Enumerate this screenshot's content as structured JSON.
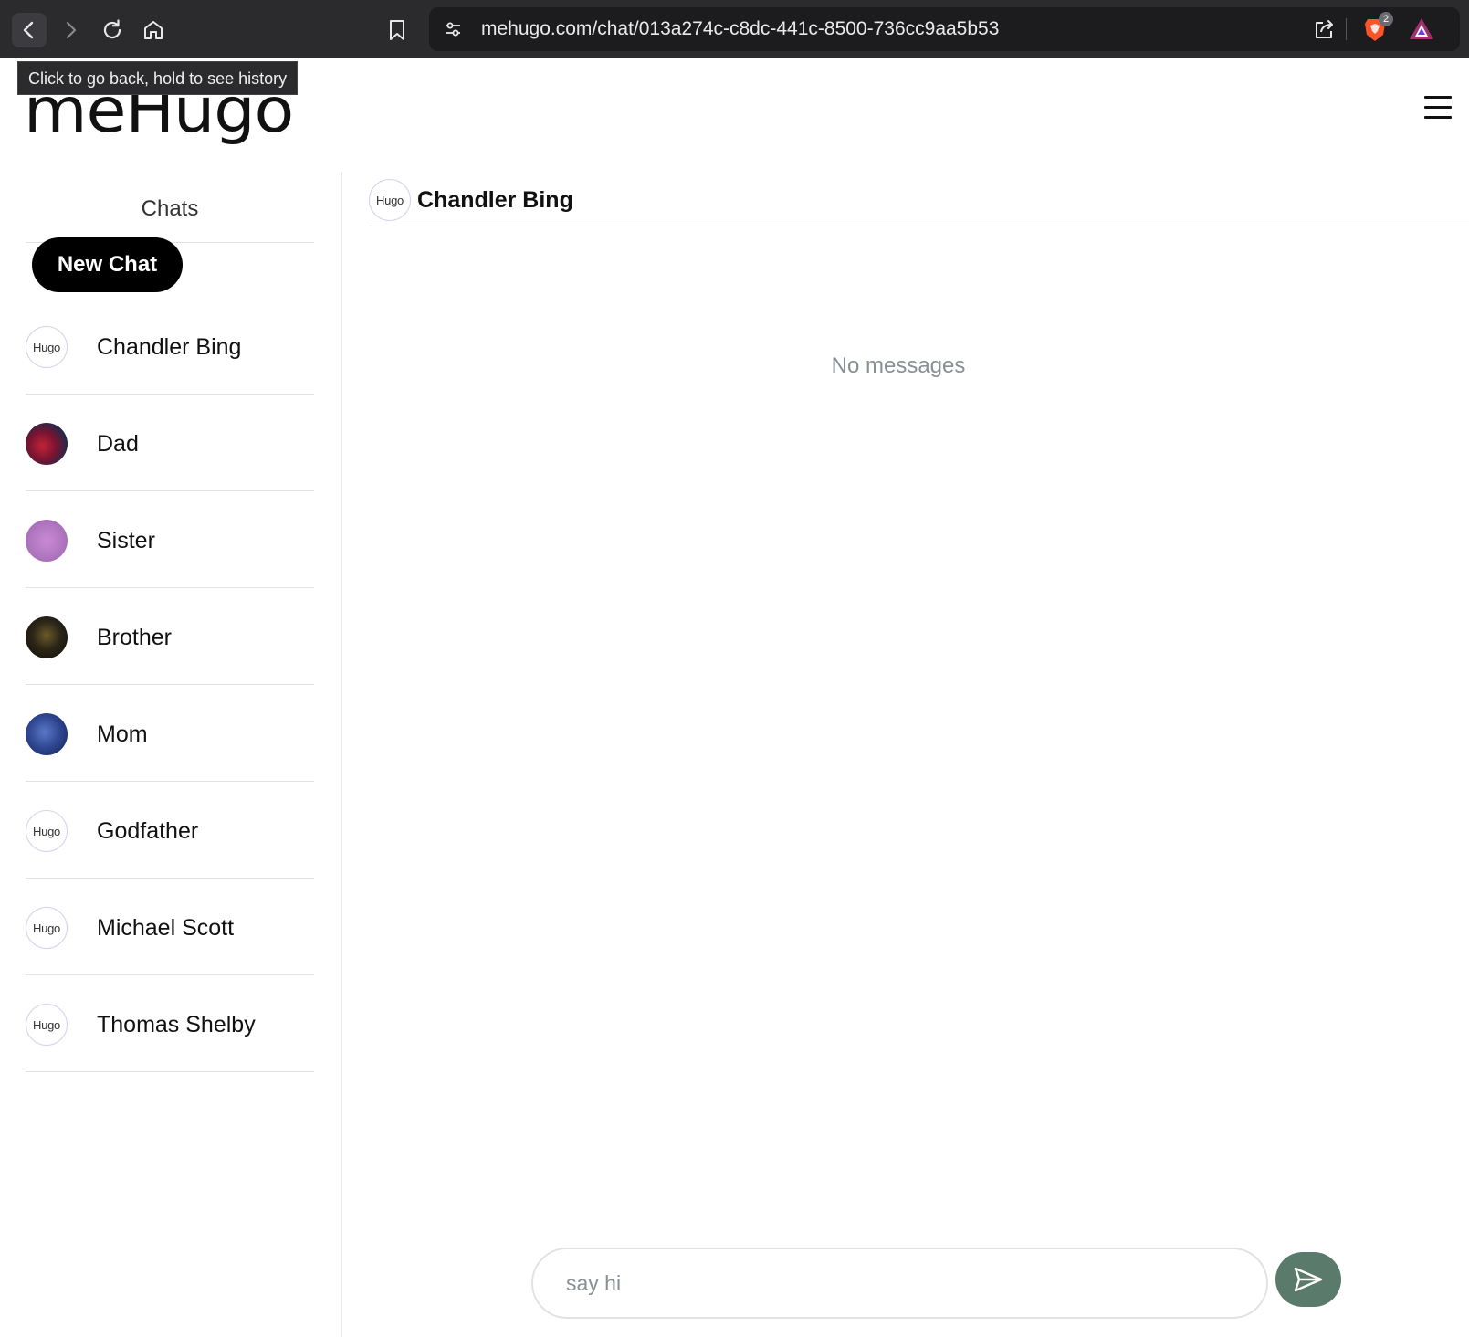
{
  "browser": {
    "url": "mehugo.com/chat/013a274c-c8dc-441c-8500-736cc9aa5b53",
    "shield_count": "2",
    "tooltip": "Click to go back, hold to see history"
  },
  "app": {
    "logo": "meHugo"
  },
  "sidebar": {
    "title": "Chats",
    "new_chat_label": "New Chat",
    "chats": [
      {
        "name": "Chandler Bing",
        "avatar": "hugo",
        "avatar_text": "Hugo"
      },
      {
        "name": "Dad",
        "avatar": "photo-red"
      },
      {
        "name": "Sister",
        "avatar": "photo-pink"
      },
      {
        "name": "Brother",
        "avatar": "photo-dark"
      },
      {
        "name": "Mom",
        "avatar": "photo-blue"
      },
      {
        "name": "Godfather",
        "avatar": "hugo",
        "avatar_text": "Hugo"
      },
      {
        "name": "Michael Scott",
        "avatar": "hugo",
        "avatar_text": "Hugo"
      },
      {
        "name": "Thomas Shelby",
        "avatar": "hugo",
        "avatar_text": "Hugo"
      }
    ]
  },
  "chat": {
    "active_name": "Chandler Bing",
    "avatar_text": "Hugo",
    "empty_text": "No messages",
    "input_placeholder": "say hi"
  },
  "colors": {
    "send_button": "#5a7a6b",
    "new_chat_button": "#000000",
    "browser_chrome": "#2b2b2e"
  }
}
